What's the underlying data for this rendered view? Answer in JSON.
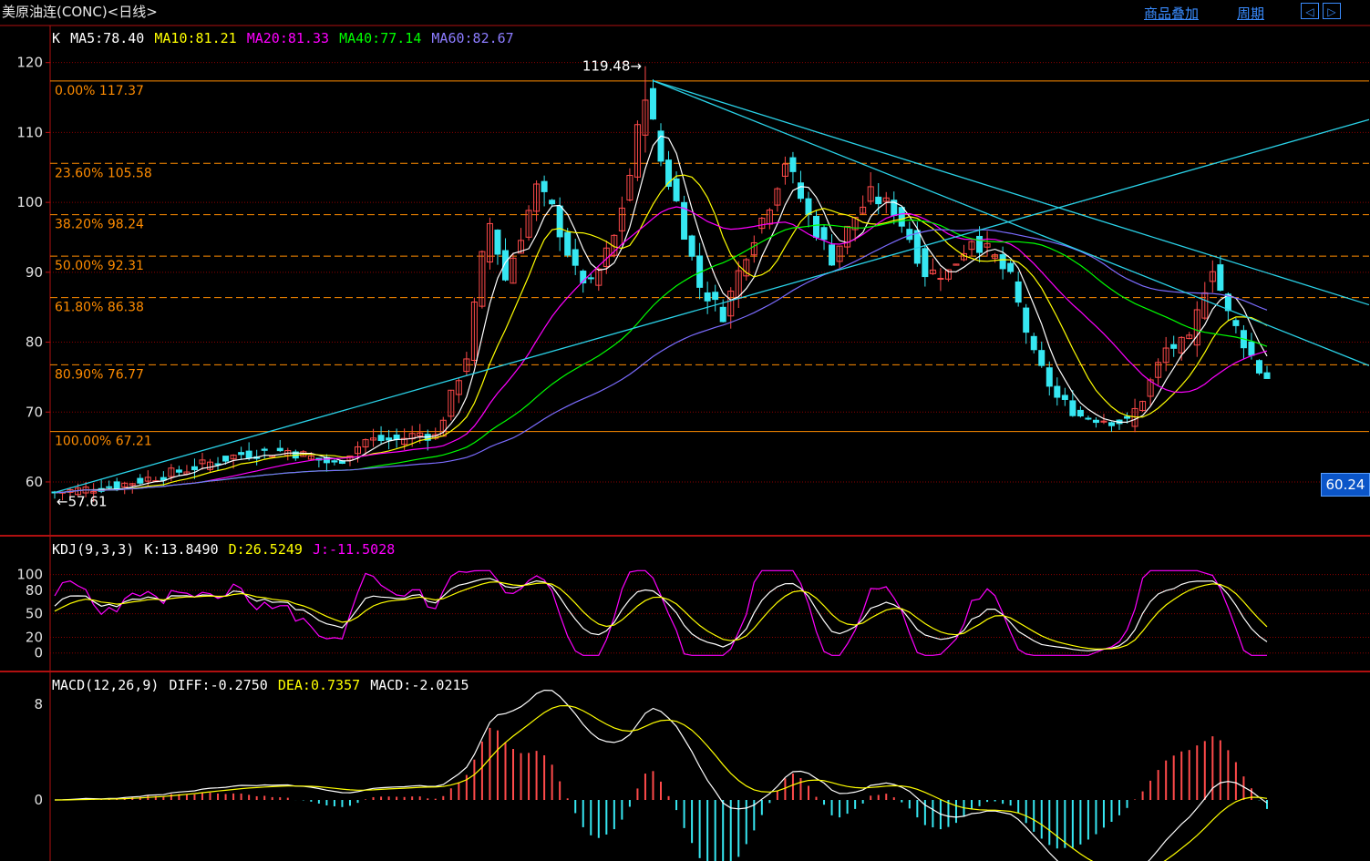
{
  "header": {
    "title": "美原油连(CONC)<日线>",
    "overlay_link": "商品叠加",
    "period_link": "周期",
    "nav_left": "◁",
    "nav_right": "▷"
  },
  "colors": {
    "background": "#000000",
    "up": "#ff4a4a",
    "down": "#36e7f2",
    "ma5": "#ffffff",
    "ma10": "#ffff00",
    "ma20": "#ff00ff",
    "ma40": "#00ff00",
    "ma60": "#7b6cff",
    "fib": "#ff8c00",
    "trend": "#2ad2e8",
    "grid": "#8b0000"
  },
  "price_legend": {
    "k": "K",
    "ma5": "MA5:78.40",
    "ma10": "MA10:81.21",
    "ma20": "MA20:81.33",
    "ma40": "MA40:77.14",
    "ma60": "MA60:82.67"
  },
  "kdj_legend": {
    "name": "KDJ(9,3,3)",
    "k": "K:13.8490",
    "d": "D:26.5249",
    "j": "J:-11.5028"
  },
  "macd_legend": {
    "name": "MACD(12,26,9)",
    "diff": "DIFF:-0.2750",
    "dea": "DEA:0.7357",
    "macd": "MACD:-2.0215"
  },
  "current_price": "60.24",
  "chart_data": [
    {
      "type": "candlestick",
      "y_axis": {
        "min": 54,
        "max": 124,
        "ticks": [
          60,
          70,
          80,
          90,
          100,
          110,
          120
        ]
      },
      "high_label": "119.48→",
      "low_label": "←57.61",
      "fib_levels": [
        {
          "label": "0.00% 117.37",
          "value": 117.37
        },
        {
          "label": "23.60% 105.58",
          "value": 105.58
        },
        {
          "label": "38.20% 98.24",
          "value": 98.24
        },
        {
          "label": "50.00% 92.31",
          "value": 92.31
        },
        {
          "label": "61.80% 86.38",
          "value": 86.38
        },
        {
          "label": "80.90% 76.77",
          "value": 76.77
        },
        {
          "label": "100.00% 67.21",
          "value": 67.21
        }
      ],
      "candle_count": 157,
      "anchors": [
        [
          0,
          58.5
        ],
        [
          8,
          59.5
        ],
        [
          16,
          61.5
        ],
        [
          24,
          64
        ],
        [
          30,
          64.5
        ],
        [
          36,
          62.5
        ],
        [
          40,
          66
        ],
        [
          44,
          66
        ],
        [
          47,
          67
        ],
        [
          49,
          66.5
        ],
        [
          53,
          78
        ],
        [
          55,
          92
        ],
        [
          56,
          97
        ],
        [
          58,
          89
        ],
        [
          62,
          102
        ],
        [
          64,
          99
        ],
        [
          67,
          90
        ],
        [
          69,
          88
        ],
        [
          72,
          95
        ],
        [
          74,
          104
        ],
        [
          76,
          116
        ],
        [
          78,
          106
        ],
        [
          80,
          100
        ],
        [
          83,
          88
        ],
        [
          86,
          84
        ],
        [
          89,
          93
        ],
        [
          92,
          100
        ],
        [
          94,
          106
        ],
        [
          97,
          98
        ],
        [
          100,
          92
        ],
        [
          103,
          98
        ],
        [
          105,
          101
        ],
        [
          108,
          99
        ],
        [
          110,
          95
        ],
        [
          112,
          90
        ],
        [
          115,
          90
        ],
        [
          118,
          95
        ],
        [
          121,
          92
        ],
        [
          123,
          89
        ],
        [
          126,
          78
        ],
        [
          129,
          72
        ],
        [
          132,
          69.5
        ],
        [
          135,
          69
        ],
        [
          138,
          68.5
        ],
        [
          140,
          72
        ],
        [
          143,
          79
        ],
        [
          146,
          80
        ],
        [
          148,
          88
        ],
        [
          149,
          91
        ],
        [
          151,
          84
        ],
        [
          153,
          80
        ],
        [
          155,
          76
        ],
        [
          156,
          75
        ]
      ]
    },
    {
      "type": "line",
      "name": "KDJ(9,3,3)",
      "y_axis": {
        "min": -5,
        "max": 110,
        "ticks": [
          100,
          80,
          50,
          20,
          0
        ]
      }
    },
    {
      "type": "bar",
      "name": "MACD(12,26,9)",
      "y_axis": {
        "min": -7.8,
        "max": 9.5,
        "ticks": [
          8,
          0
        ]
      }
    }
  ]
}
